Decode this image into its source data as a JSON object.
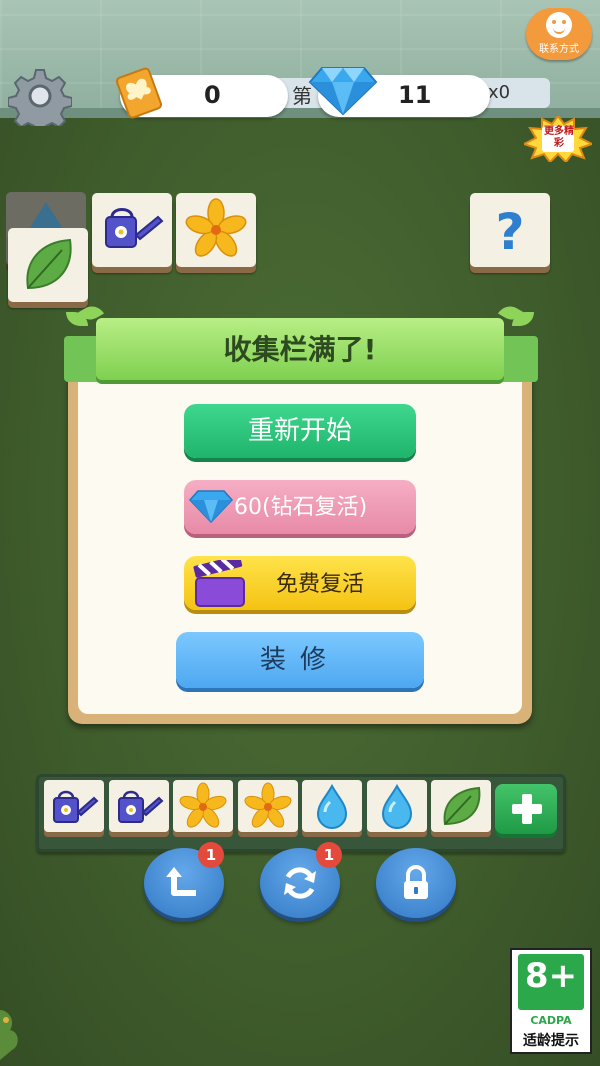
{
  "header": {
    "coins": "0",
    "gems": "11",
    "level_prefix": "第",
    "multiplier": "x0",
    "contact_label": "联系方式",
    "more_label": "更多精彩"
  },
  "board_tiles": [
    {
      "kind": "water-drop-icon",
      "dim": true
    },
    {
      "kind": "leaf-icon",
      "dim": false
    },
    {
      "kind": "watering-can-icon",
      "dim": false
    },
    {
      "kind": "flower-icon",
      "dim": false
    },
    {
      "kind": "question-icon",
      "dim": false
    }
  ],
  "dialog": {
    "title": "收集栏满了!",
    "restart_label": "重新开始",
    "revive_gem_label": "60(钻石复活)",
    "revive_free_label": "免费复活",
    "decorate_label": "装修"
  },
  "tray": {
    "slots": [
      "watering-can-icon",
      "watering-can-icon",
      "flower-icon",
      "flower-icon",
      "water-drop-icon",
      "water-drop-icon",
      "leaf-icon"
    ]
  },
  "tools": {
    "undo_badge": "1",
    "shuffle_badge": "1"
  },
  "age_rating": {
    "value": "8+",
    "org": "CADPA",
    "label": "适龄提示"
  },
  "colors": {
    "restart": "#1fb46b",
    "revive_gem": "#e78aa8",
    "revive_free": "#f4c313",
    "decorate": "#4ea8f0",
    "banner": "#7fd050"
  }
}
